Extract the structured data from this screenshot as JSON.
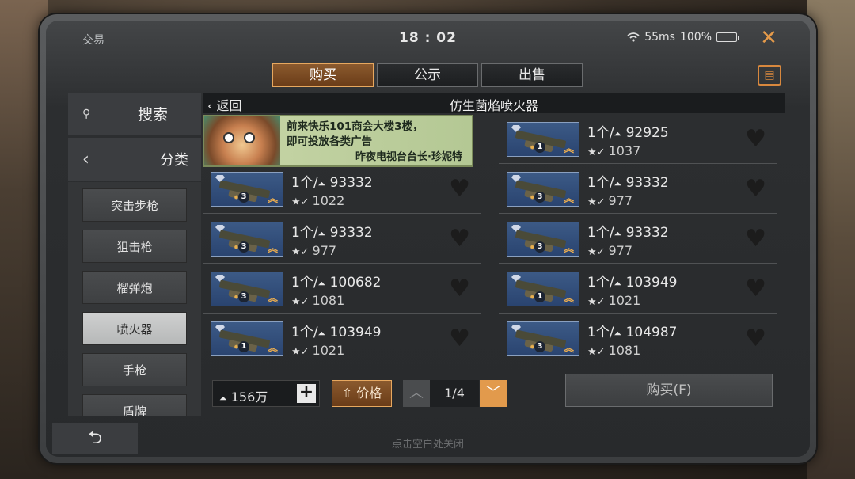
{
  "status": {
    "app_title": "交易",
    "clock": "18 : 02",
    "ping": "55ms",
    "battery": "100%"
  },
  "tabs": [
    {
      "label": "购买",
      "active": true
    },
    {
      "label": "公示",
      "active": false
    },
    {
      "label": "出售",
      "active": false
    }
  ],
  "sidebar": {
    "search_label": "搜索",
    "category_label": "分类",
    "items": [
      {
        "label": "突击步枪",
        "active": false
      },
      {
        "label": "狙击枪",
        "active": false
      },
      {
        "label": "榴弹炮",
        "active": false
      },
      {
        "label": "喷火器",
        "active": true
      },
      {
        "label": "手枪",
        "active": false
      },
      {
        "label": "盾牌",
        "active": false
      }
    ]
  },
  "header": {
    "back_label": "返回",
    "title": "仿生菌焰喷火器"
  },
  "ad": {
    "line1": "前来快乐101商会大楼3楼，",
    "line2": "即可投放各类广告",
    "signature": "昨夜电视台台长·珍妮特"
  },
  "listings_left": [
    {
      "qty": "1个/",
      "price": "93332",
      "level": "3",
      "seller_score": "1022"
    },
    {
      "qty": "1个/",
      "price": "93332",
      "level": "3",
      "seller_score": "977"
    },
    {
      "qty": "1个/",
      "price": "100682",
      "level": "3",
      "seller_score": "1081"
    },
    {
      "qty": "1个/",
      "price": "103949",
      "level": "1",
      "seller_score": "1021"
    }
  ],
  "listings_right": [
    {
      "qty": "1个/",
      "price": "92925",
      "level": "1",
      "seller_score": "1037"
    },
    {
      "qty": "1个/",
      "price": "93332",
      "level": "3",
      "seller_score": "977"
    },
    {
      "qty": "1个/",
      "price": "93332",
      "level": "3",
      "seller_score": "977"
    },
    {
      "qty": "1个/",
      "price": "103949",
      "level": "1",
      "seller_score": "1021"
    },
    {
      "qty": "1个/",
      "price": "104987",
      "level": "3",
      "seller_score": "1081"
    }
  ],
  "footer": {
    "balance": "156万",
    "sort_label": "价格",
    "page": "1/4",
    "buy_label": "购买(F)",
    "close_hint": "点击空白处关闭"
  },
  "colors": {
    "accent_orange": "#e29a4c",
    "tab_active_bg": "#8b5a2e",
    "thumb_blue": "#3c5a86"
  }
}
